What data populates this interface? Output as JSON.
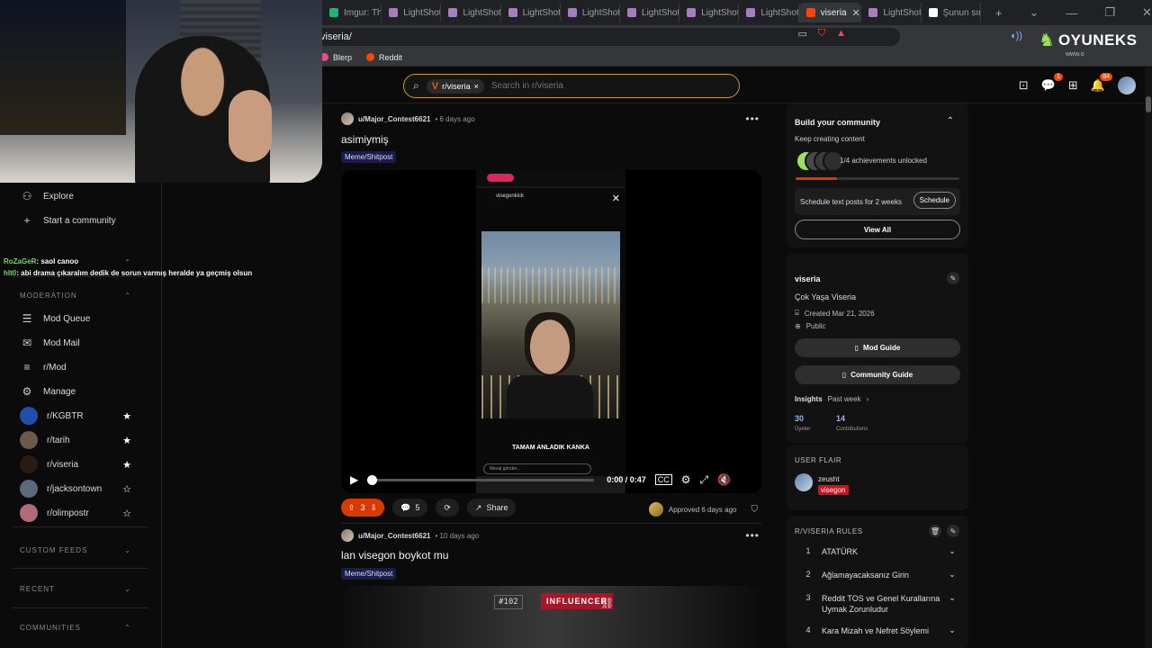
{
  "browser": {
    "tabs": [
      {
        "label": "Imgur: The",
        "color": "#1bb76e"
      },
      {
        "label": "LightShot",
        "color": "#a77dc2"
      },
      {
        "label": "LightShot",
        "color": "#a77dc2"
      },
      {
        "label": "LightShot",
        "color": "#a77dc2"
      },
      {
        "label": "LightShot",
        "color": "#a77dc2"
      },
      {
        "label": "LightShot",
        "color": "#a77dc2"
      },
      {
        "label": "LightShot",
        "color": "#a77dc2"
      },
      {
        "label": "LightShot",
        "color": "#a77dc2"
      },
      {
        "label": "viseria",
        "color": "#ff4500",
        "active": true
      },
      {
        "label": "LightShot",
        "color": "#a77dc2"
      },
      {
        "label": "Şunun sırr",
        "color": "#ffffff"
      }
    ],
    "url": "viseria/",
    "bookmarks": [
      "Blerp",
      "Reddit"
    ]
  },
  "brand": {
    "name": "OYUNEKS",
    "sub": "www.o"
  },
  "header": {
    "search_chip": "r/viseria",
    "search_placeholder": "Search in r/viseria",
    "chat_badge": "1",
    "inbox_badge": "84"
  },
  "chat_overlay": [
    {
      "user": "RoZaGeR",
      "text": ": saol canoo"
    },
    {
      "user": "hlt0",
      "text": ": abi drama çıkaralım dedik de sorun varmış heralde ya geçmiş olsun"
    }
  ],
  "sidebar": {
    "top_items": [
      {
        "label": "Explore",
        "icon": "explore-icon",
        "glyph": "⚇"
      },
      {
        "label": "Start a community",
        "icon": "plus-icon",
        "glyph": "+"
      }
    ],
    "moderation_header": "MODERATION",
    "moderation_items": [
      {
        "label": "Mod Queue",
        "icon": "mod-queue-icon",
        "glyph": "☰"
      },
      {
        "label": "Mod Mail",
        "icon": "mod-mail-icon",
        "glyph": "✉"
      },
      {
        "label": "r/Mod",
        "icon": "mod-feed-icon",
        "glyph": "≡"
      },
      {
        "label": "Manage",
        "icon": "gear-icon",
        "glyph": "⚙"
      }
    ],
    "subreddits": [
      {
        "label": "r/KGBTR",
        "starred": true,
        "color": "#1f4fa8"
      },
      {
        "label": "r/tarih",
        "starred": true,
        "color": "#6a5a4a"
      },
      {
        "label": "r/viseria",
        "starred": true,
        "color": "#2a1a14"
      },
      {
        "label": "r/jacksontown",
        "starred": false,
        "color": "#5a6a7a"
      },
      {
        "label": "r/olimpostr",
        "starred": false,
        "color": "#b06a7a"
      }
    ],
    "custom_feeds": "CUSTOM FEEDS",
    "recent": "RECENT",
    "communities": "COMMUNITIES"
  },
  "posts": [
    {
      "author": "u/Major_Contest6621",
      "time": "6 days ago",
      "title": "asimiymiş",
      "flair": "Meme/Shitpost",
      "story_user": "visegonkick",
      "story_caption": "TAMAM ANLADIK KANKA",
      "story_reply": "Mesaj gönder...",
      "timecode": "0:00 / 0:47",
      "progress": 0,
      "votes": "3",
      "comments": "5",
      "share": "Share",
      "approved": "Approved 6 days ago"
    },
    {
      "author": "u/Major_Contest6621",
      "time": "10 days ago",
      "title": "lan visegon boykot mu",
      "flair": "Meme/Shitpost",
      "tag_number": "#102",
      "tag_label": "INFLUENCER"
    }
  ],
  "rail": {
    "build": {
      "title": "Build your community",
      "subtitle": "Keep creating content",
      "achievements": "1/4 achievements unlocked",
      "achievement_progress": 0.25,
      "schedule_text": "Schedule text posts for 2 weeks",
      "schedule_btn": "Schedule",
      "view_all": "View All"
    },
    "about": {
      "name": "viseria",
      "tagline": "Çok Yaşa Viseria",
      "created": "Created Mar 21, 2026",
      "visibility": "Public",
      "mod_guide": "Mod Guide",
      "community_guide": "Community Guide",
      "insights": "Insights",
      "period": "Past week",
      "members": "30",
      "members_label": "Üyeler",
      "contributions": "14",
      "contributions_label": "Contributions"
    },
    "user_flair": {
      "header": "USER FLAIR",
      "username": "zeusht",
      "flair": "visegon"
    },
    "rules": {
      "header": "R/VISERIA RULES",
      "items": [
        {
          "num": "1",
          "text": "ATATÜRK"
        },
        {
          "num": "2",
          "text": "Ağlamayacaksanız Girin"
        },
        {
          "num": "3",
          "text": "Reddit TOS ve Genel Kurallarına Uymak Zorunludur"
        },
        {
          "num": "4",
          "text": "Kara Mizah ve Nefret Söylemi"
        }
      ]
    }
  }
}
